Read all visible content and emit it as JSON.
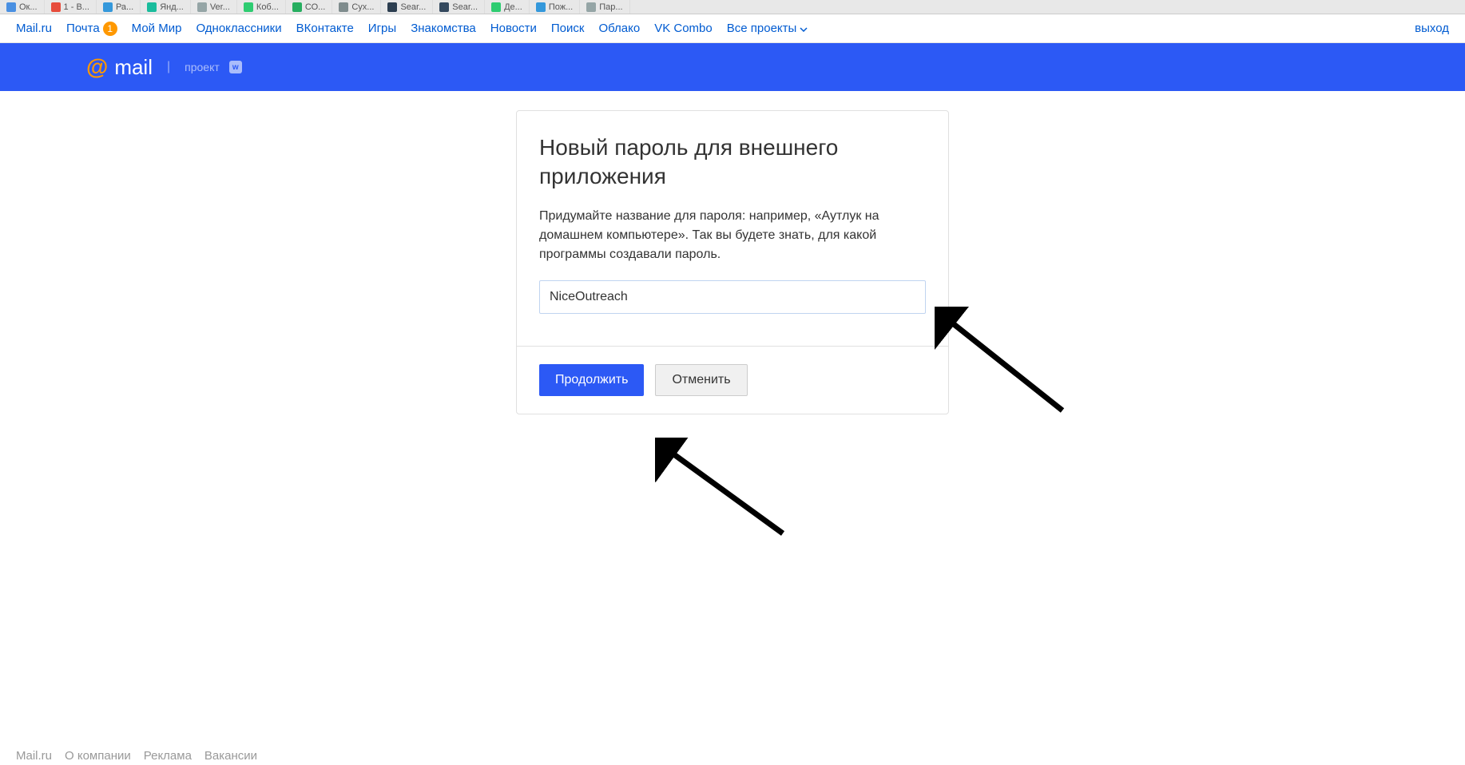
{
  "browser_tabs": [
    {
      "label": "Ок...",
      "color": "#4a90e2"
    },
    {
      "label": "1 - В...",
      "color": "#e74c3c"
    },
    {
      "label": "Ра...",
      "color": "#3498db"
    },
    {
      "label": "Янд...",
      "color": "#1abc9c"
    },
    {
      "label": "Ver...",
      "color": "#95a5a6"
    },
    {
      "label": "Коб...",
      "color": "#2ecc71"
    },
    {
      "label": "СО...",
      "color": "#27ae60"
    },
    {
      "label": "Сух...",
      "color": "#7f8c8d"
    },
    {
      "label": "Sear...",
      "color": "#2c3e50"
    },
    {
      "label": "Sear...",
      "color": "#34495e"
    },
    {
      "label": "Де...",
      "color": "#2ecc71"
    },
    {
      "label": "Пож...",
      "color": "#3498db"
    },
    {
      "label": "Пар...",
      "color": "#95a5a6"
    }
  ],
  "top_nav": {
    "items": [
      {
        "label": "Mail.ru"
      },
      {
        "label": "Почта",
        "badge": "1"
      },
      {
        "label": "Мой Мир"
      },
      {
        "label": "Одноклассники"
      },
      {
        "label": "ВКонтакте"
      },
      {
        "label": "Игры"
      },
      {
        "label": "Знакомства"
      },
      {
        "label": "Новости"
      },
      {
        "label": "Поиск"
      },
      {
        "label": "Облако"
      },
      {
        "label": "VK Combo"
      },
      {
        "label": "Все проекты",
        "dropdown": true
      }
    ],
    "logout": "выход"
  },
  "header": {
    "logo_at": "@",
    "logo_text": "mail",
    "project_text": "проект",
    "vk_glyph": "w"
  },
  "card": {
    "title": "Новый пароль для внешнего приложения",
    "description": "Придумайте название для пароля: например, «Аутлук на домашнем компьютере». Так вы будете знать, для какой программы создавали пароль.",
    "input_value": "NiceOutreach",
    "continue_button": "Продолжить",
    "cancel_button": "Отменить"
  },
  "footer": {
    "links": [
      "Mail.ru",
      "О компании",
      "Реклама",
      "Вакансии"
    ]
  }
}
